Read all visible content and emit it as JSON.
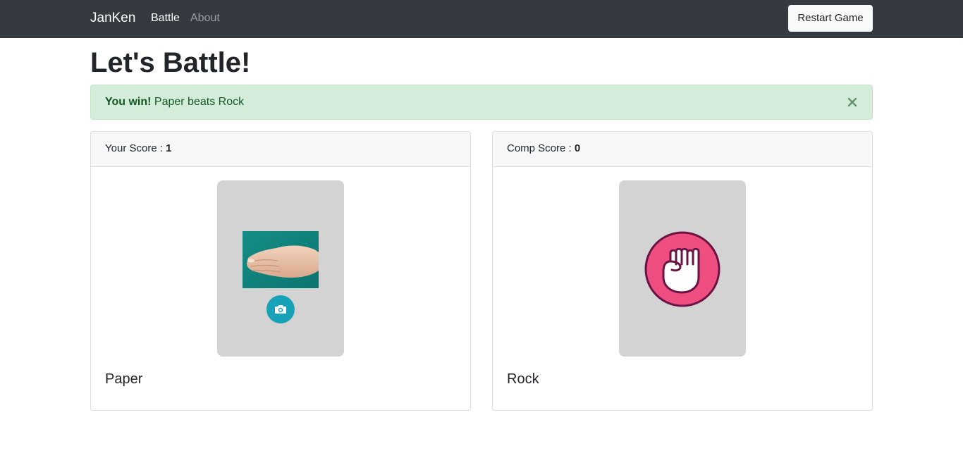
{
  "navbar": {
    "brand": "JanKen",
    "links": [
      {
        "label": "Battle",
        "active": true
      },
      {
        "label": "About",
        "active": false
      }
    ],
    "restart_label": "Restart Game"
  },
  "page": {
    "title": "Let's Battle!"
  },
  "alert": {
    "strong": "You win!",
    "message": " Paper beats Rock",
    "close_glyph": "×"
  },
  "player": {
    "score_label": "Your Score : ",
    "score": "1",
    "choice": "Paper",
    "image": "camera-photo-hand",
    "camera_icon": "camera-icon"
  },
  "computer": {
    "score_label": "Comp Score : ",
    "score": "0",
    "choice": "Rock",
    "icon": "fist-icon"
  },
  "colors": {
    "navbar_bg": "#343a40",
    "alert_bg": "#d4edda",
    "alert_text": "#155724",
    "camera_button": "#17a2b8",
    "rock_circle": "#ef4f80",
    "rock_outline": "#6b1245",
    "hand_box": "#d3d3d3"
  }
}
